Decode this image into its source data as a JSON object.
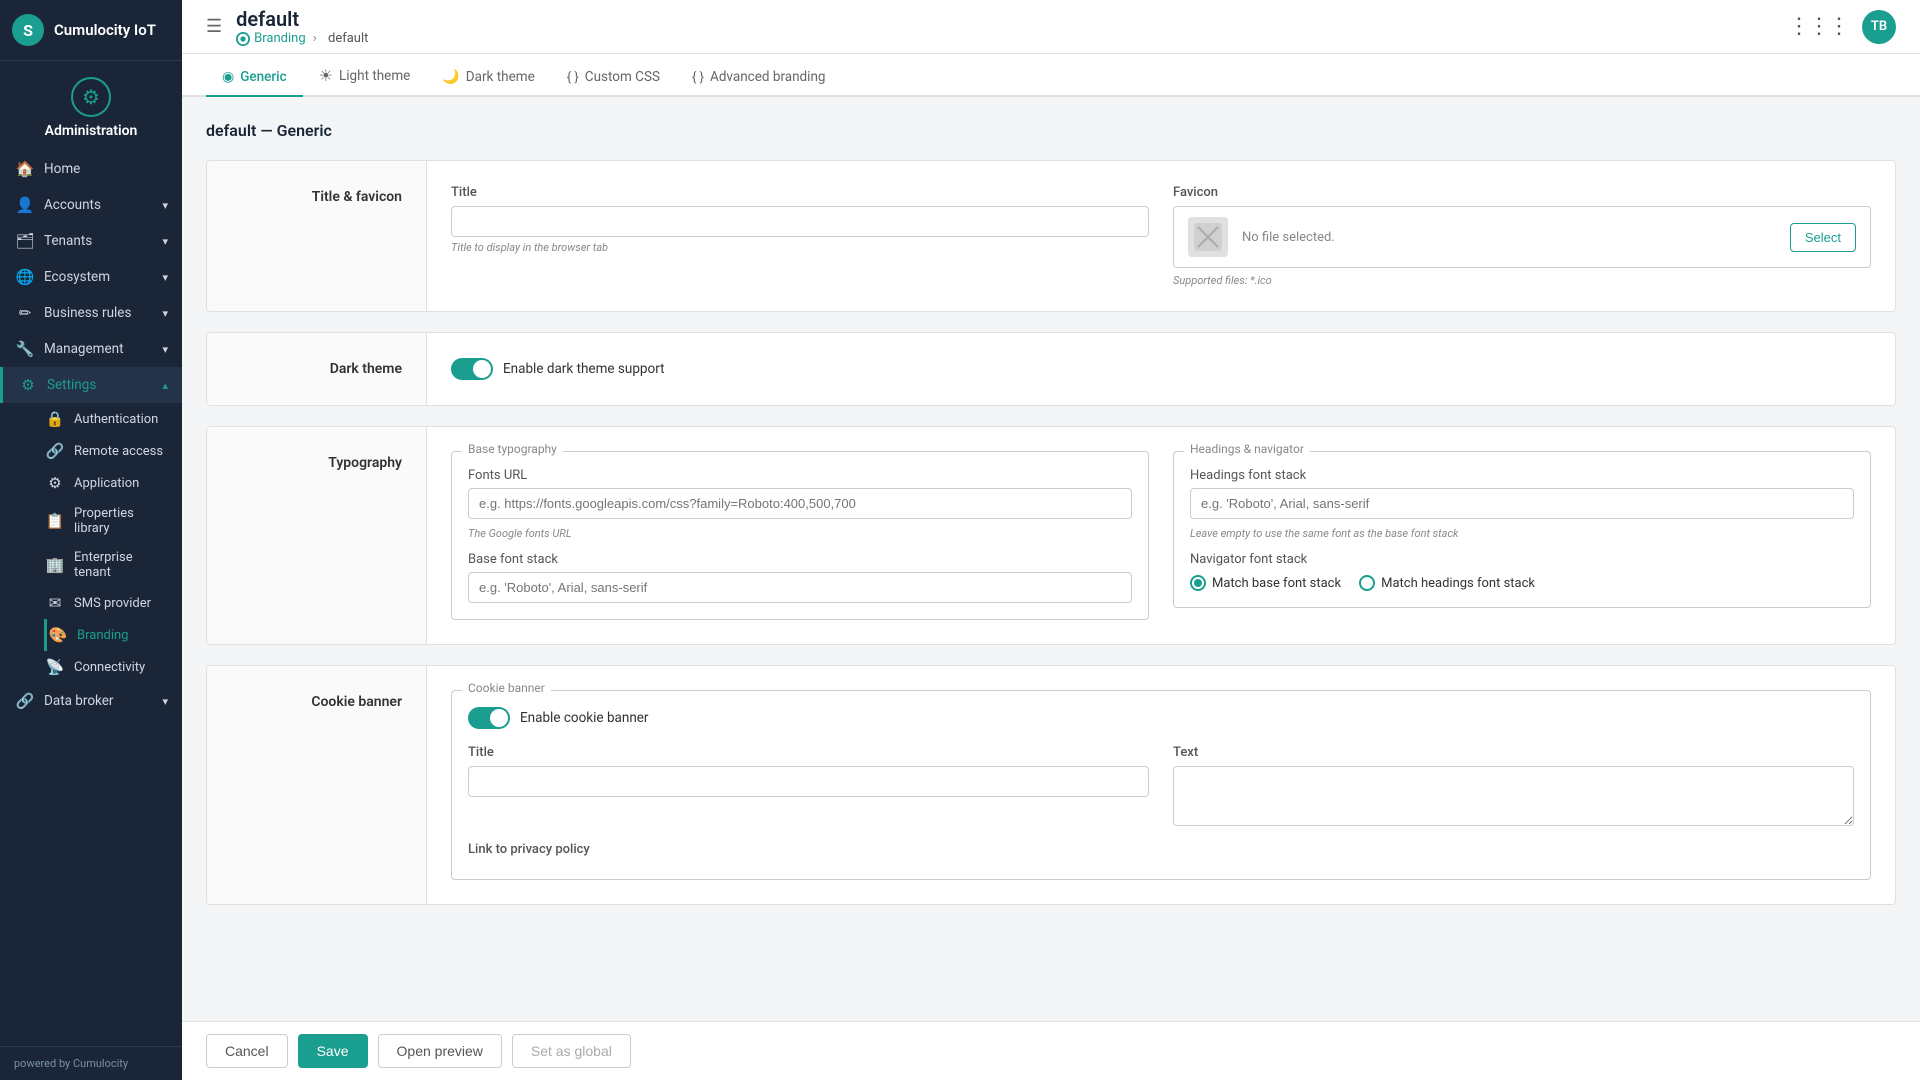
{
  "app": {
    "logo_letter": "S",
    "name": "Cumulocity IoT",
    "user_initials": "TB"
  },
  "sidebar": {
    "admin_icon": "⚙",
    "admin_label": "Administration",
    "items": [
      {
        "id": "home",
        "icon": "🏠",
        "label": "Home",
        "arrow": false,
        "active": false
      },
      {
        "id": "accounts",
        "icon": "👤",
        "label": "Accounts",
        "arrow": true,
        "active": false
      },
      {
        "id": "tenants",
        "icon": "🗂",
        "label": "Tenants",
        "arrow": true,
        "active": false
      },
      {
        "id": "ecosystem",
        "icon": "🌐",
        "label": "Ecosystem",
        "arrow": true,
        "active": false
      },
      {
        "id": "business-rules",
        "icon": "✏",
        "label": "Business rules",
        "arrow": true,
        "active": false
      },
      {
        "id": "management",
        "icon": "🔧",
        "label": "Management",
        "arrow": true,
        "active": false
      },
      {
        "id": "settings",
        "icon": "⚙",
        "label": "Settings",
        "arrow": true,
        "active": true
      },
      {
        "id": "data-broker",
        "icon": "🔗",
        "label": "Data broker",
        "arrow": true,
        "active": false
      }
    ],
    "settings_sub": [
      {
        "id": "authentication",
        "label": "Authentication",
        "active": false
      },
      {
        "id": "remote-access",
        "label": "Remote access",
        "active": false
      },
      {
        "id": "application",
        "label": "Application",
        "active": false
      },
      {
        "id": "properties-library",
        "label": "Properties library",
        "active": false
      },
      {
        "id": "enterprise-tenant",
        "label": "Enterprise tenant",
        "active": false
      },
      {
        "id": "sms-provider",
        "label": "SMS provider",
        "active": false
      },
      {
        "id": "branding",
        "label": "Branding",
        "active": true
      },
      {
        "id": "connectivity",
        "label": "Connectivity",
        "active": false
      }
    ],
    "footer": "powered by Cumulocity"
  },
  "topbar": {
    "page_title": "default",
    "breadcrumb_parent": "Branding",
    "breadcrumb_separator": ">",
    "breadcrumb_current": "default",
    "grid_icon": "⋮⋮⋮"
  },
  "tabs": [
    {
      "id": "generic",
      "label": "Generic",
      "icon": "◉",
      "active": true
    },
    {
      "id": "light-theme",
      "label": "Light theme",
      "icon": "☀",
      "active": false
    },
    {
      "id": "dark-theme",
      "label": "Dark theme",
      "icon": "🌙",
      "active": false
    },
    {
      "id": "custom-css",
      "label": "Custom CSS",
      "icon": "{ }",
      "active": false
    },
    {
      "id": "advanced-branding",
      "label": "Advanced branding",
      "icon": "{ }",
      "active": false
    }
  ],
  "content": {
    "heading": "default — Generic",
    "sections": {
      "title_favicon": {
        "label": "Title & favicon",
        "title_label": "Title",
        "title_placeholder": "",
        "title_hint": "Title to display in the browser tab",
        "favicon_label": "Favicon",
        "favicon_no_file": "No file selected.",
        "favicon_btn": "Select",
        "favicon_supported": "Supported files: *.ico"
      },
      "dark_theme": {
        "label": "Dark theme",
        "toggle_label": "Enable dark theme support",
        "toggle_on": true
      },
      "typography": {
        "label": "Typography",
        "base_legend": "Base typography",
        "fonts_url_label": "Fonts URL",
        "fonts_url_placeholder": "e.g. https://fonts.googleapis.com/css?family=Roboto:400,500,700",
        "fonts_url_hint": "The Google fonts URL",
        "base_font_label": "Base font stack",
        "base_font_placeholder": "e.g. 'Roboto', Arial, sans-serif",
        "headings_legend": "Headings & navigator",
        "headings_font_label": "Headings font stack",
        "headings_font_placeholder": "e.g. 'Roboto', Arial, sans-serif",
        "headings_font_hint": "Leave empty to use the same font as the base font stack",
        "navigator_font_label": "Navigator font stack",
        "radio_match_base": "Match base font stack",
        "radio_match_headings": "Match headings font stack"
      },
      "cookie_banner": {
        "label": "Cookie banner",
        "legend": "Cookie banner",
        "toggle_label": "Enable cookie banner",
        "toggle_on": true,
        "title_label": "Title",
        "title_value": "",
        "text_label": "Text",
        "text_value": "",
        "privacy_label": "Link to privacy policy"
      }
    }
  },
  "bottom_bar": {
    "cancel": "Cancel",
    "save": "Save",
    "open_preview": "Open preview",
    "set_as_global": "Set as global"
  }
}
